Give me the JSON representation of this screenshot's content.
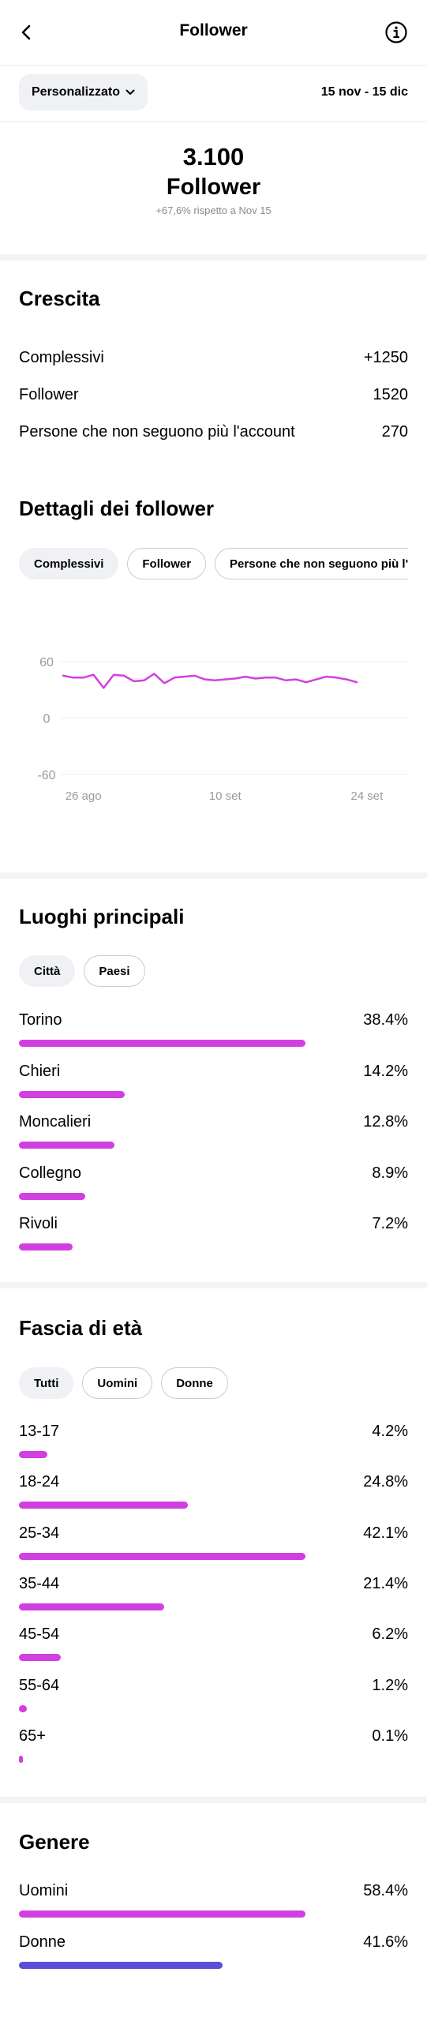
{
  "header": {
    "title": "Follower",
    "back_icon": "back-chevron-icon",
    "info_icon": "info-icon"
  },
  "filters": {
    "period": "Personalizzato",
    "date_range": "15 nov - 15 dic"
  },
  "summary": {
    "count": "3.100",
    "label": "Follower",
    "change": "+67,6% rispetto a Nov 15"
  },
  "growth": {
    "title": "Crescita",
    "rows": [
      {
        "label": "Complessivi",
        "value": "+1250"
      },
      {
        "label": "Follower",
        "value": "1520"
      },
      {
        "label": "Persone che non seguono più l'account",
        "value": "270"
      }
    ]
  },
  "follower_details": {
    "title": "Dettagli dei follower",
    "tabs": [
      {
        "label": "Complessivi",
        "selected": true
      },
      {
        "label": "Follower",
        "selected": false
      },
      {
        "label": "Persone che non seguono più l'account",
        "selected": false
      }
    ]
  },
  "chart_data": {
    "type": "line",
    "y_tick_labels": [
      "60",
      "0",
      "-60"
    ],
    "ylim": [
      -60,
      60
    ],
    "x_tick_labels": [
      "26 ago",
      "10 set",
      "24 set"
    ],
    "x_tick_index": [
      2,
      16,
      30
    ],
    "grid": true,
    "color": "#d23fe1",
    "series": [
      {
        "values": [
          45,
          43,
          43,
          46,
          32,
          46,
          45,
          39,
          40,
          47,
          37,
          43,
          44,
          45,
          41,
          40,
          41,
          42,
          44,
          42,
          43,
          43,
          40,
          41,
          38,
          41,
          44,
          43,
          41,
          38
        ]
      }
    ]
  },
  "top_locations": {
    "title": "Luoghi principali",
    "tabs": [
      {
        "label": "Città",
        "selected": true
      },
      {
        "label": "Paesi",
        "selected": false
      }
    ],
    "items": [
      {
        "label": "Torino",
        "value": "38.4%",
        "fraction": 1.0
      },
      {
        "label": "Chieri",
        "value": "14.2%",
        "fraction": 0.37
      },
      {
        "label": "Moncalieri",
        "value": "12.8%",
        "fraction": 0.333
      },
      {
        "label": "Collegno",
        "value": "8.9%",
        "fraction": 0.232
      },
      {
        "label": "Rivoli",
        "value": "7.2%",
        "fraction": 0.188
      }
    ]
  },
  "age_ranges": {
    "title": "Fascia di età",
    "tabs": [
      {
        "label": "Tutti",
        "selected": true
      },
      {
        "label": "Uomini",
        "selected": false
      },
      {
        "label": "Donne",
        "selected": false
      }
    ],
    "items": [
      {
        "label": "13-17",
        "value": "4.2%",
        "fraction": 0.1
      },
      {
        "label": "18-24",
        "value": "24.8%",
        "fraction": 0.589
      },
      {
        "label": "25-34",
        "value": "42.1%",
        "fraction": 1.0
      },
      {
        "label": "35-44",
        "value": "21.4%",
        "fraction": 0.508
      },
      {
        "label": "45-54",
        "value": "6.2%",
        "fraction": 0.147
      },
      {
        "label": "55-64",
        "value": "1.2%",
        "fraction": 0.028
      },
      {
        "label": "65+",
        "value": "0.1%",
        "fraction": 0.002
      }
    ]
  },
  "gender": {
    "title": "Genere",
    "items": [
      {
        "label": "Uomini",
        "value": "58.4%",
        "fraction": 1.0,
        "color": "#d23fe1"
      },
      {
        "label": "Donne",
        "value": "41.6%",
        "fraction": 0.712,
        "color": "#5b4fd8"
      }
    ]
  }
}
